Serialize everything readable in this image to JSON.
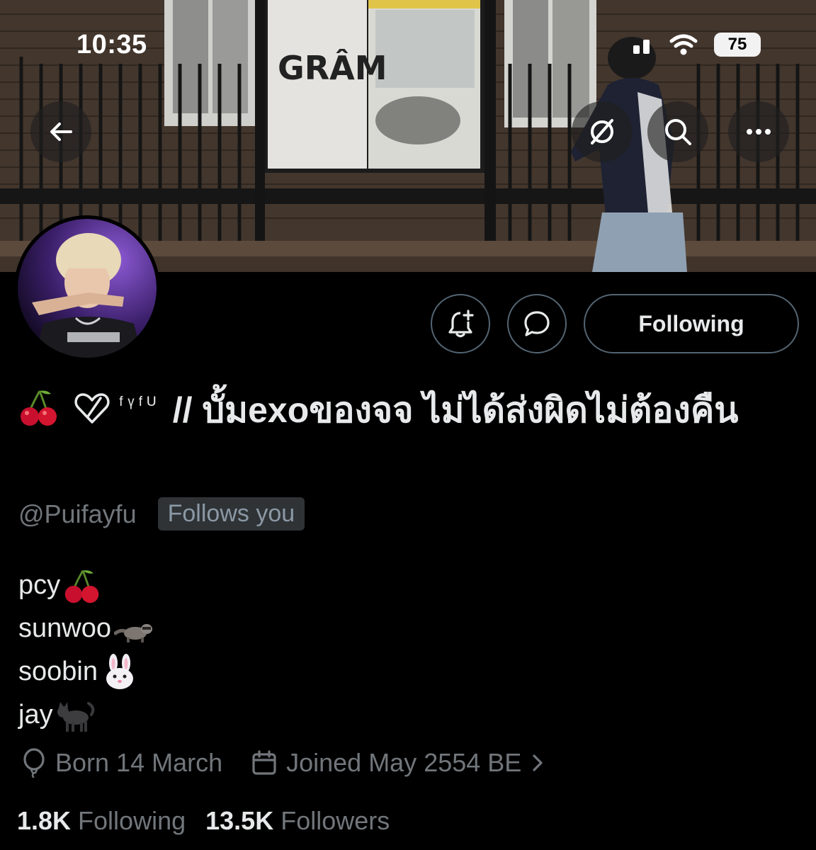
{
  "status_bar": {
    "time": "10:35",
    "battery": "75"
  },
  "header": {
    "back_icon": "arrow-left-icon",
    "grok_icon": "grok-slash-icon",
    "search_icon": "search-icon",
    "more_icon": "ellipsis-icon"
  },
  "profile": {
    "display_name_mid": "ᶠᵞᶠᵁ",
    "display_name_text": "// บั้มexoของจจ ไม่ได้ส่งผิดไม่ต้องคืน",
    "handle": "@Puifayfu",
    "follows_you": "Follows you",
    "following_button": "Following",
    "bio": [
      {
        "text": "pcy",
        "emoji": "cherries"
      },
      {
        "text": "sunwoo",
        "emoji": "raccoon"
      },
      {
        "text": "soobin",
        "emoji": "rabbit-face"
      },
      {
        "text": "jay",
        "emoji": "black-cat"
      }
    ],
    "birthday": "Born 14 March",
    "joined": "Joined May 2554 BE",
    "following_count": "1.8K",
    "following_label": "Following",
    "followers_count": "13.5K",
    "followers_label": "Followers"
  },
  "colors": {
    "background": "#000000",
    "text_primary": "#e7e9ea",
    "text_secondary": "#71767b",
    "border": "#536471"
  }
}
